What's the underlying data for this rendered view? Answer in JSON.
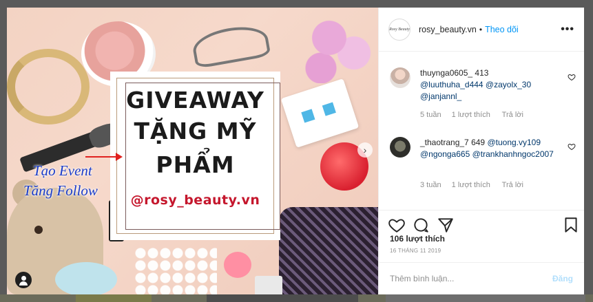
{
  "colors": {
    "accent": "#0095f6",
    "mention": "#00376b",
    "muted": "#8e8e8e",
    "poster_handle": "#c5172d",
    "event_text": "#1a3cc9",
    "arrow": "#e0211f"
  },
  "photo": {
    "poster": {
      "line1": "GIVEAWAY",
      "line2": "TẶNG MỸ",
      "line3": "PHẨM",
      "handle": "@rosy_beauty.vn"
    },
    "overlay_text": {
      "line1": "Tạo Event",
      "line2": "Tăng Follow"
    },
    "icons": {
      "user_tag": "user-tag-icon",
      "next": "chevron-right-icon"
    }
  },
  "header": {
    "avatar_text": "Rosy Beauty",
    "username": "rosy_beauty.vn",
    "separator": "•",
    "follow_label": "Theo dõi",
    "more_label": "•••"
  },
  "comments": [
    {
      "username": "thuynga0605_",
      "text": "413",
      "mentions": "@luuthuha_d444 @zayolx_30 @janjannl_",
      "time": "5 tuần",
      "likes": "1 lượt thích",
      "reply": "Trả lời"
    },
    {
      "username": "_thaotrang_7",
      "text": "649",
      "mention_inline": "@tuong.vy109",
      "mentions": "@ngonga665 @trankhanhngoc2007",
      "time": "3 tuần",
      "likes": "1 lượt thích",
      "reply": "Trả lời"
    }
  ],
  "actions": {
    "likes_count": "106 lượt thích",
    "date": "16 THÁNG 11 2019"
  },
  "add_comment": {
    "placeholder": "Thêm bình luận...",
    "post_label": "Đăng"
  }
}
